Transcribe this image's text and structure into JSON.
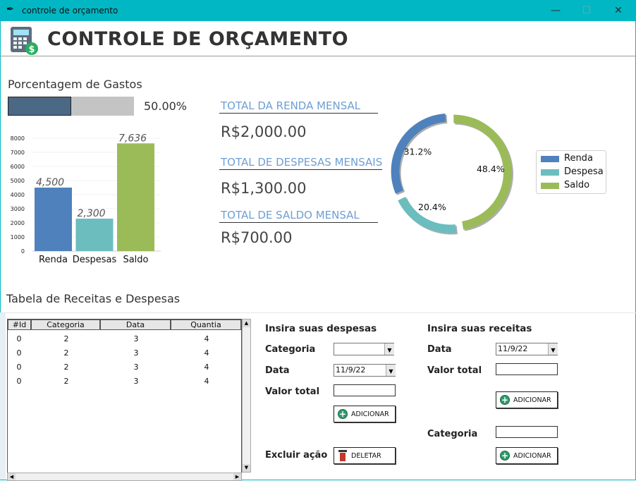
{
  "window": {
    "title": "controle de orçamento",
    "minimize": "—",
    "maximize": "☐",
    "close": "✕"
  },
  "header": {
    "title": "CONTROLE DE ORÇAMENTO",
    "icon": "calculator-dollar-icon"
  },
  "spending": {
    "title": "Porcentagem de Gastos",
    "percent_text": "50.00%",
    "progress": 0.5
  },
  "bar_chart": {
    "type": "bar",
    "categories": [
      "Renda",
      "Despesas",
      "Saldo"
    ],
    "values": [
      4500,
      2300,
      7636
    ],
    "value_labels": [
      "4,500",
      "2,300",
      "7,636"
    ],
    "ylim": [
      0,
      8000
    ],
    "yticks": [
      "0",
      "1000",
      "2000",
      "3000",
      "4000",
      "5000",
      "6000",
      "7000",
      "8000"
    ],
    "colors": [
      "#4f81bd",
      "#6cbdbe",
      "#9bbb59"
    ]
  },
  "kpis": [
    {
      "label": "TOTAL DA RENDA MENSAL",
      "value": "R$2,000.00"
    },
    {
      "label": "TOTAL DE DESPESAS MENSAIS",
      "value": "R$1,300.00"
    },
    {
      "label": "TOTAL DE SALDO MENSAL",
      "value": "R$700.00"
    }
  ],
  "chart_data": {
    "type": "pie",
    "categories": [
      "Renda",
      "Despesa",
      "Saldo"
    ],
    "values": [
      31.2,
      20.4,
      48.4
    ],
    "labels": [
      "31.2%",
      "20.4%",
      "48.4%"
    ],
    "colors": [
      "#4f81bd",
      "#6cbdbe",
      "#9bbb59"
    ],
    "legend": "right"
  },
  "table": {
    "title": "Tabela de Receitas e Despesas",
    "headers": [
      "#Id",
      "Categoria",
      "Data",
      "Quantia"
    ],
    "rows": [
      [
        "0",
        "2",
        "3",
        "4"
      ],
      [
        "0",
        "2",
        "3",
        "4"
      ],
      [
        "0",
        "2",
        "3",
        "4"
      ],
      [
        "0",
        "2",
        "3",
        "4"
      ]
    ]
  },
  "expense_form": {
    "title": "Insira suas despesas",
    "category_label": "Categoria",
    "category_value": "",
    "date_label": "Data",
    "date_value": "11/9/22",
    "amount_label": "Valor total",
    "amount_value": "",
    "add_label": "ADICIONAR",
    "delete_label": "Excluir ação",
    "delete_button": "DELETAR"
  },
  "income_form": {
    "title": "Insira suas receitas",
    "date_label": "Data",
    "date_value": "11/9/22",
    "amount_label": "Valor total",
    "amount_value": "",
    "add_label": "ADICIONAR",
    "category_label": "Categoria",
    "category_value": "",
    "add2_label": "ADICIONAR"
  }
}
